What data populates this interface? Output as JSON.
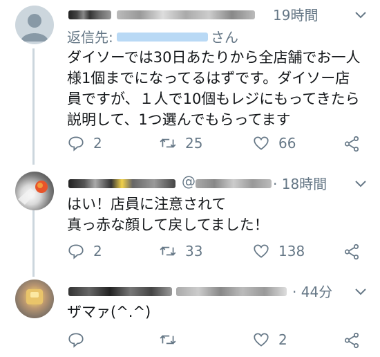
{
  "tweets": [
    {
      "time": "19時間",
      "reply_prefix": "返信先:",
      "reply_suffix": "さん",
      "text_lines": [
        "ダイソーでは30日あたりから全店舗でお一人",
        "様1個までになってるはずです。ダイソー店",
        "員ですが、１人で10個もレジにもってきたら",
        "説明して、1つ選んでもらってます"
      ],
      "replies": "2",
      "retweets": "25",
      "likes": "66"
    },
    {
      "handle_prefix": "@",
      "time": "· 18時間",
      "text_lines": [
        "はい！店員に注意されて",
        "真っ赤な顔して戻してました！"
      ],
      "replies": "2",
      "retweets": "33",
      "likes": "138"
    },
    {
      "time": "· 44分",
      "text_lines": [
        "ザマァ(^.^)"
      ],
      "replies": "",
      "retweets": "",
      "likes": "2"
    }
  ],
  "colors": {
    "text": "#14171a",
    "secondary": "#657786",
    "mention": "#1da1f2",
    "thread_line": "#ccd6dd"
  },
  "icons": [
    "default-avatar-icon",
    "chevron-down-icon",
    "reply-icon",
    "retweet-icon",
    "like-icon",
    "share-icon"
  ]
}
